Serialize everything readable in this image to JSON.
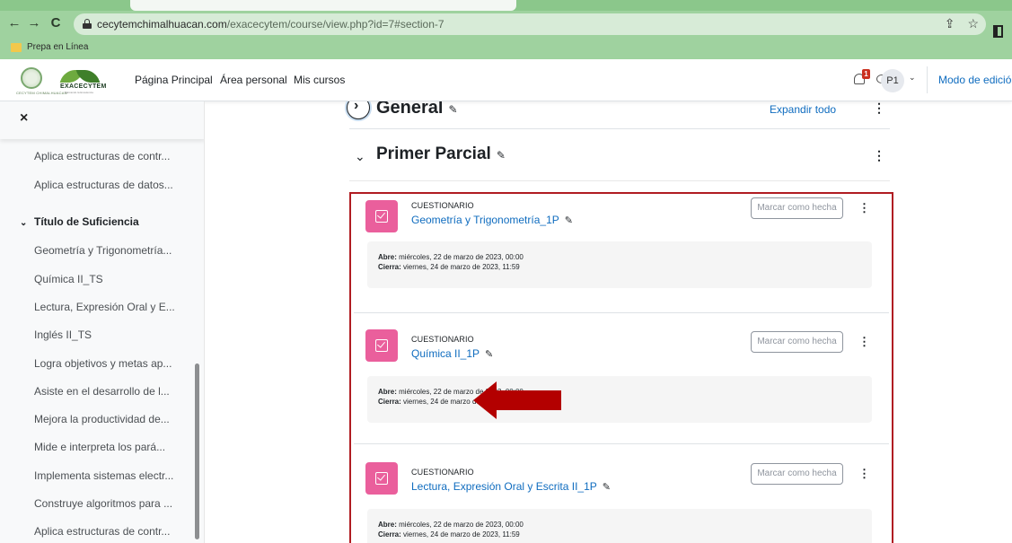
{
  "browser": {
    "back": "←",
    "forward": "→",
    "reload": "C",
    "url_host": "cecytemchimalhuacan.com",
    "url_path": "/exacecytem/course/view.php?id=7#section-7",
    "share_icon": "share-icon",
    "star_icon": "star-icon",
    "bookmark_label": "Prepa en Línea"
  },
  "navbar": {
    "logo_small_text": "CECYTEM CHIMALHUACAN",
    "brand": "EXACECYTEM",
    "brand_sub": "Marcando la Excelencia",
    "links": [
      "Página Principal",
      "Área personal",
      "Mis cursos"
    ],
    "notification_count": "1",
    "avatar_initials": "P1",
    "edit_mode_label": "Modo de edición"
  },
  "drawer": {
    "close": "×",
    "items_top": [
      "Aplica estructuras de contr...",
      "Aplica estructuras de datos..."
    ],
    "section_title": "Título de Suficiencia",
    "items": [
      "Geometría y Trigonometría...",
      "Química II_TS",
      "Lectura, Expresión Oral y E...",
      "Inglés II_TS",
      "Logra objetivos y metas ap...",
      "Asiste en el desarrollo de l...",
      "Mejora la productividad de...",
      "Mide e interpreta los pará...",
      "Implementa sistemas electr...",
      "Construye algoritmos para ...",
      "Aplica estructuras de contr..."
    ]
  },
  "main": {
    "general_title": "General",
    "expand_all": "Expandir todo",
    "section_title": "Primer Parcial",
    "activities": [
      {
        "type": "CUESTIONARIO",
        "name": "Geometría y Trigonometría_1P",
        "mark_label": "Marcar como hecha",
        "opens_label": "Abre:",
        "opens": "miércoles, 22 de marzo de 2023, 00:00",
        "closes_label": "Cierra:",
        "closes": "viernes, 24 de marzo de 2023, 11:59"
      },
      {
        "type": "CUESTIONARIO",
        "name": "Química II_1P",
        "mark_label": "Marcar como hecha",
        "opens_label": "Abre:",
        "opens": "miércoles, 22 de marzo de 2023, 00:00",
        "closes_label": "Cierra:",
        "closes": "viernes, 24 de marzo de 2023, 11:59"
      },
      {
        "type": "CUESTIONARIO",
        "name": "Lectura, Expresión Oral y Escrita II_1P",
        "mark_label": "Marcar como hecha",
        "opens_label": "Abre:",
        "opens": "miércoles, 22 de marzo de 2023, 00:00",
        "closes_label": "Cierra:",
        "closes": "viernes, 24 de marzo de 2023, 11:59"
      }
    ]
  },
  "colors": {
    "browser_theme": "#9fd29f",
    "link": "#0f6cbf",
    "quiz_icon": "#ea5f9c",
    "highlight_border": "#b01c22",
    "arrow": "#b30000"
  }
}
